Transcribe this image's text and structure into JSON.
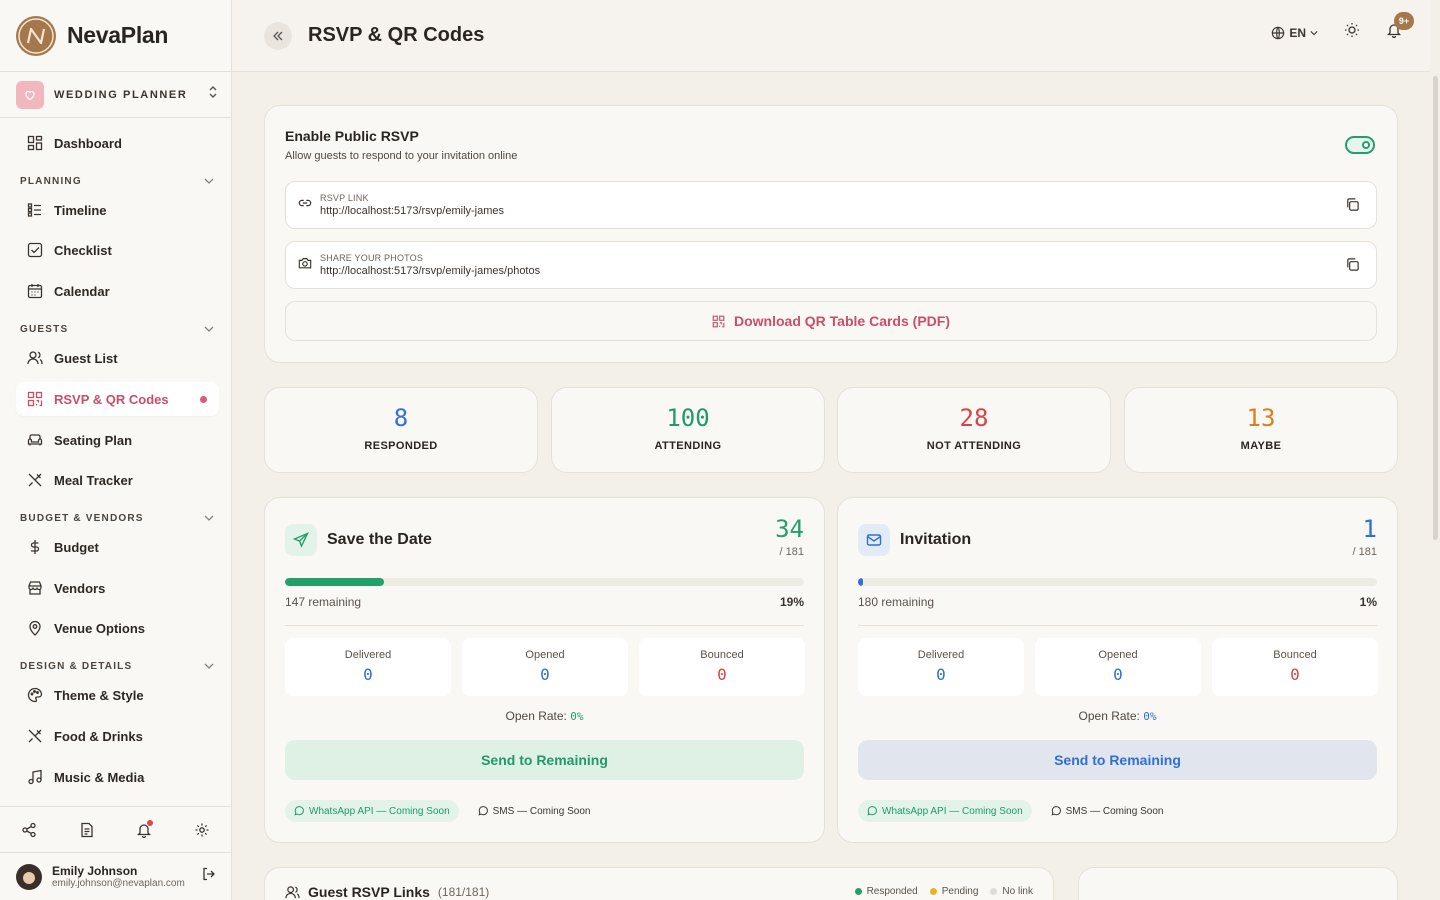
{
  "brand": {
    "name": "NevaPlan"
  },
  "workspace": {
    "name": "WEDDING PLANNER"
  },
  "nav": {
    "dashboard": "Dashboard",
    "sections": {
      "planning": "PLANNING",
      "guests": "GUESTS",
      "budget": "BUDGET & VENDORS",
      "design": "DESIGN & DETAILS"
    },
    "timeline": "Timeline",
    "checklist": "Checklist",
    "calendar": "Calendar",
    "guest_list": "Guest List",
    "rsvp": "RSVP & QR Codes",
    "seating": "Seating Plan",
    "meal": "Meal Tracker",
    "budget": "Budget",
    "vendors": "Vendors",
    "venue": "Venue Options",
    "theme": "Theme & Style",
    "food": "Food & Drinks",
    "music": "Music & Media"
  },
  "user": {
    "name": "Emily Johnson",
    "email": "emily.johnson@nevaplan.com"
  },
  "header": {
    "title": "RSVP & QR Codes",
    "language": "EN",
    "notifications_badge": "9+"
  },
  "rsvp": {
    "title": "Enable Public RSVP",
    "subtitle": "Allow guests to respond to your invitation online",
    "enabled": true,
    "link_label": "RSVP LINK",
    "link_url": "http://localhost:5173/rsvp/emily-james",
    "photos_label": "SHARE YOUR PHOTOS",
    "photos_url": "http://localhost:5173/rsvp/emily-james/photos",
    "download_label": "Download QR Table Cards (PDF)"
  },
  "stats": [
    {
      "value": "8",
      "label": "RESPONDED",
      "color": "#2f6fd6"
    },
    {
      "value": "100",
      "label": "ATTENDING",
      "color": "#1f9a6a"
    },
    {
      "value": "28",
      "label": "NOT ATTENDING",
      "color": "#d64545"
    },
    {
      "value": "13",
      "label": "MAYBE",
      "color": "#d9801e"
    }
  ],
  "campaigns": [
    {
      "title": "Save the Date",
      "sent": "34",
      "total": "/ 181",
      "progress": 0.19,
      "remaining": "147 remaining",
      "percent": "19%",
      "delivered_label": "Delivered",
      "delivered": "0",
      "opened_label": "Opened",
      "opened": "0",
      "bounced_label": "Bounced",
      "bounced": "0",
      "open_rate_label": "Open Rate:",
      "open_rate": "0%",
      "send_label": "Send to Remaining",
      "whatsapp": "WhatsApp API — Coming Soon",
      "sms": "SMS — Coming Soon",
      "accent": "#22a06b"
    },
    {
      "title": "Invitation",
      "sent": "1",
      "total": "/ 181",
      "progress": 0.01,
      "remaining": "180 remaining",
      "percent": "1%",
      "delivered_label": "Delivered",
      "delivered": "0",
      "opened_label": "Opened",
      "opened": "0",
      "bounced_label": "Bounced",
      "bounced": "0",
      "open_rate_label": "Open Rate:",
      "open_rate": "0%",
      "send_label": "Send to Remaining",
      "whatsapp": "WhatsApp API — Coming Soon",
      "sms": "SMS — Coming Soon",
      "accent": "#2f6fd6"
    }
  ],
  "guest_links": {
    "title": "Guest RSVP Links",
    "count": "(181/181)",
    "legend": {
      "responded": "Responded",
      "pending": "Pending",
      "no_link": "No link"
    }
  }
}
